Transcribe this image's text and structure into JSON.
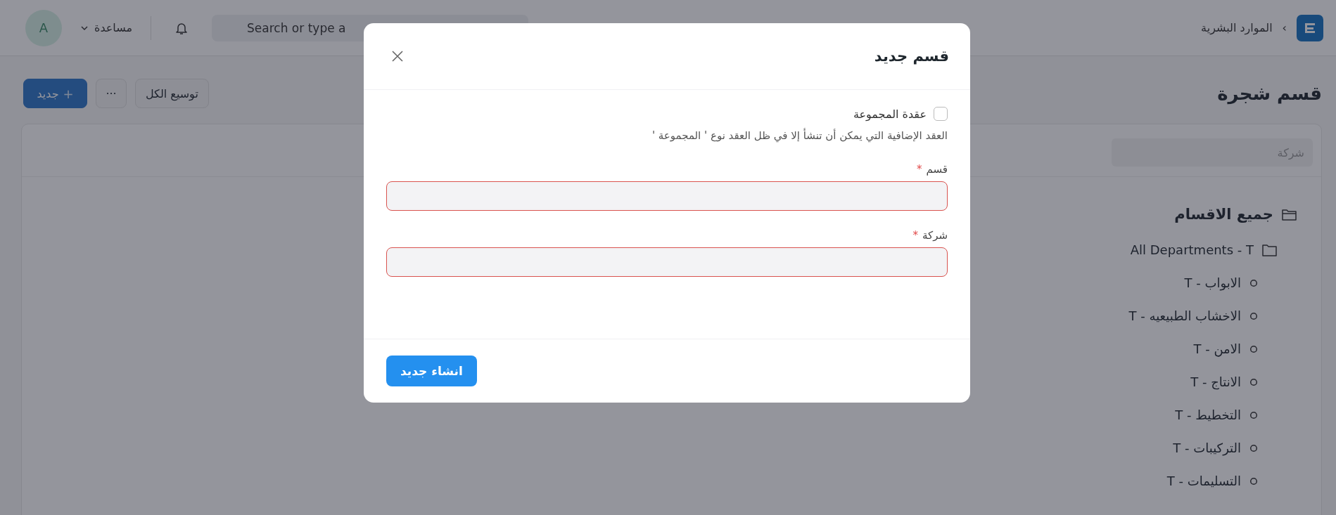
{
  "navbar": {
    "breadcrumb": [
      "الموارد البشرية"
    ],
    "breadcrumb_separator": "›",
    "search": {
      "placeholder": "Search or type a"
    },
    "help": "مساعدة",
    "avatar": "A"
  },
  "page": {
    "title": "قسم شجرة",
    "buttons": [
      {
        "kind": "secondary",
        "label": "توسيع الكل"
      },
      {
        "kind": "more",
        "label": "···"
      },
      {
        "kind": "primary",
        "label": "جديد",
        "icon_text": "+"
      }
    ]
  },
  "filter": {
    "placeholder": "شركة"
  },
  "tree": [
    {
      "label": "جميع الاقسام",
      "children": [
        {
          "label": "All Departments - T",
          "children": [
            {
              "label": "الابواب - T"
            },
            {
              "label": "الاخشاب الطبيعيه - T"
            },
            {
              "label": "الامن - T"
            },
            {
              "label": "الانتاج - T"
            },
            {
              "label": "التخطيط - T"
            },
            {
              "label": "التركيبات - T"
            },
            {
              "label": "التسليمات - T"
            }
          ]
        }
      ]
    }
  ],
  "dialog": {
    "title": "قسم جديد",
    "checkbox": {
      "label": "عقدة المجموعة",
      "checked": false
    },
    "help_text": "العقد الإضافية التي يمكن أن تنشأ إلا في ظل العقد نوع ' المجموعة '",
    "fields": [
      {
        "label": "قسم",
        "required_mark": "*",
        "invalid": true
      },
      {
        "label": "شركة",
        "required_mark": "*",
        "invalid": true
      }
    ],
    "primary_button": "انشاء جديد"
  }
}
